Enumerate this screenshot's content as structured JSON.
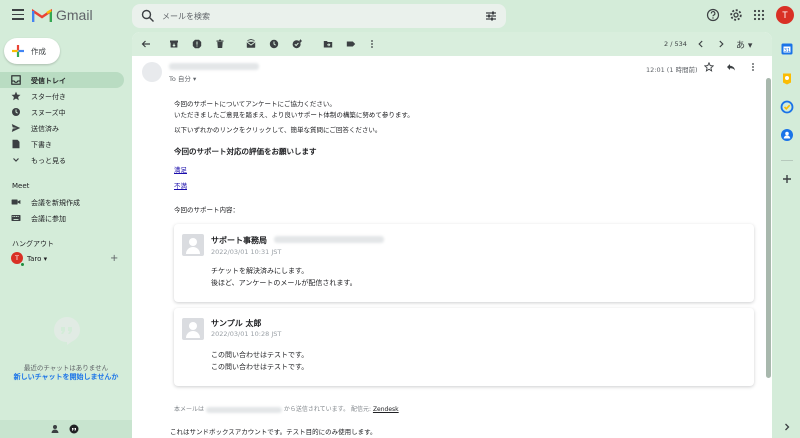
{
  "header": {
    "app_name": "Gmail",
    "search_placeholder": "メールを検索",
    "avatar_initial": "T"
  },
  "sidebar": {
    "compose_label": "作成",
    "items": [
      {
        "label": "受信トレイ",
        "icon": "inbox-icon",
        "active": true
      },
      {
        "label": "スター付き",
        "icon": "star-icon"
      },
      {
        "label": "スヌーズ中",
        "icon": "clock-icon"
      },
      {
        "label": "送信済み",
        "icon": "send-icon"
      },
      {
        "label": "下書き",
        "icon": "draft-icon"
      },
      {
        "label": "もっと見る",
        "icon": "chevron-down-icon"
      }
    ],
    "meet": {
      "title": "Meet",
      "items": [
        {
          "label": "会議を新規作成",
          "icon": "video-icon"
        },
        {
          "label": "会議に参加",
          "icon": "keyboard-icon"
        }
      ]
    },
    "hangouts": {
      "title": "ハングアウト",
      "user_initial": "T",
      "user_name": "Taro"
    },
    "no_chats": "最近のチャットはありません",
    "start_chat": "新しいチャットを開始しませんか"
  },
  "toolbar": {
    "pager": "2 / 534",
    "input_tool": "あ"
  },
  "email": {
    "to_line": "To 自分",
    "time": "12:01 (1 時間前)",
    "intro_1": "今回のサポートについてアンケートにご協力ください。",
    "intro_2": "いただきましたご意見を踏まえ、より良いサポート体制の構築に努めて参ります。",
    "intro_3": "以下いずれかのリンクをクリックして、簡単な質問にご回答ください。",
    "heading": "今回のサポート対応の評価をお願いします",
    "link_good": "満足",
    "link_bad": "不満",
    "content_label": "今回のサポート内容：",
    "messages": [
      {
        "name": "サポート事務局",
        "date": "2022/03/01 10:31 JST",
        "line1": "チケットを解決済みにします。",
        "line2": "後ほど、アンケートのメールが配信されます。"
      },
      {
        "name": "サンプル 太郎",
        "date": "2022/03/01 10:28 JST",
        "line1": "この問い合わせはテストです。",
        "line2": "この問い合わせはテストです。"
      }
    ],
    "footer_prefix": "本メールは",
    "footer_suffix": "から送信されています。 配信元:",
    "footer_brand": "Zendesk",
    "sandbox_note": "これはサンドボックスアカウントです。テスト目的にのみ使用します。"
  },
  "colors": {
    "background": "#d4ecd9",
    "accent_red": "#d93025",
    "link_blue": "#1a73e8"
  }
}
